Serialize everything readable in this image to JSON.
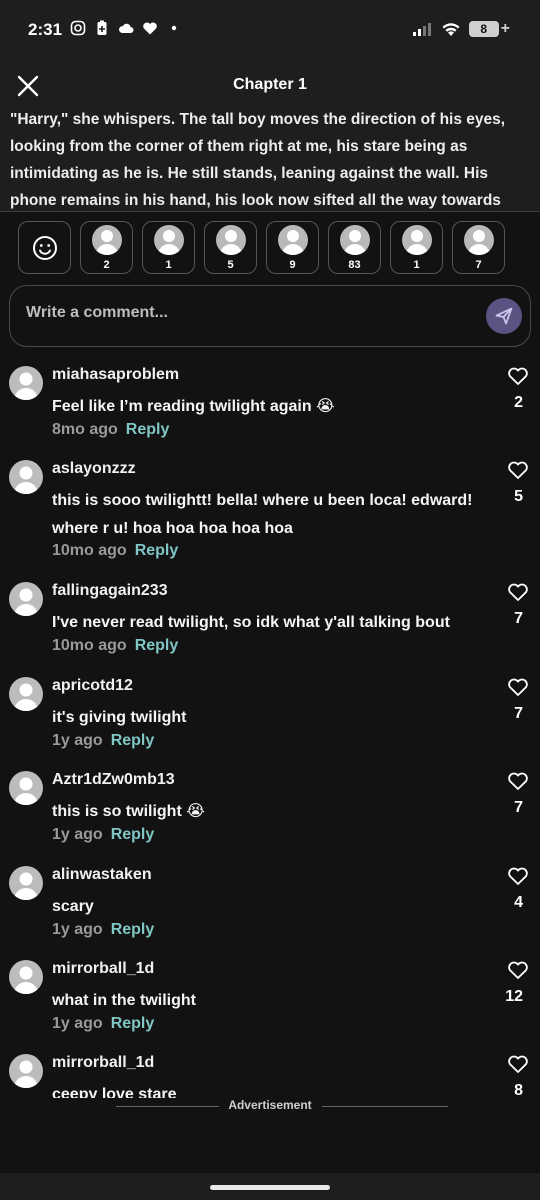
{
  "status_bar": {
    "time": "2:31",
    "battery": "8"
  },
  "header": {
    "title": "Chapter 1"
  },
  "story": {
    "text": "\"Harry,\" she whispers. The tall boy moves the direction of his eyes, looking from the corner of them right at me, his stare being as intimidating as he is. He still stands, leaning against the wall. His phone remains in his hand, his look now sifted all the way towards"
  },
  "reactions": {
    "counts": [
      "2",
      "1",
      "5",
      "9",
      "83",
      "1",
      "7"
    ]
  },
  "comment_input": {
    "placeholder": "Write a comment..."
  },
  "comments": [
    {
      "user": "miahasaproblem",
      "text": "Feel like I’m reading twilight again 😭",
      "age": "8mo ago",
      "reply": "Reply",
      "likes": "2"
    },
    {
      "user": "aslayonzzz",
      "text": "this is sooo twilightt! bella! where u been loca! edward! where r u! hoa hoa hoa hoa hoa",
      "age": "10mo ago",
      "reply": "Reply",
      "likes": "5"
    },
    {
      "user": "fallingagain233",
      "text": "I've never read twilight, so idk what y'all talking bout",
      "age": "10mo ago",
      "reply": "Reply",
      "likes": "7"
    },
    {
      "user": "apricotd12",
      "text": "it's giving twilight",
      "age": "1y ago",
      "reply": "Reply",
      "likes": "7"
    },
    {
      "user": "Aztr1dZw0mb13",
      "text": "this is so twilight 😭",
      "age": "1y ago",
      "reply": "Reply",
      "likes": "7"
    },
    {
      "user": "alinwastaken",
      "text": "scary",
      "age": "1y ago",
      "reply": "Reply",
      "likes": "4"
    },
    {
      "user": "mirrorball_1d",
      "text": "what in the twilight",
      "age": "1y ago",
      "reply": "Reply",
      "likes": "12"
    },
    {
      "user": "mirrorball_1d",
      "text": "ceepy love stare",
      "age": "",
      "reply": "",
      "likes": "8"
    }
  ],
  "ad": {
    "label": "Advertisement"
  }
}
